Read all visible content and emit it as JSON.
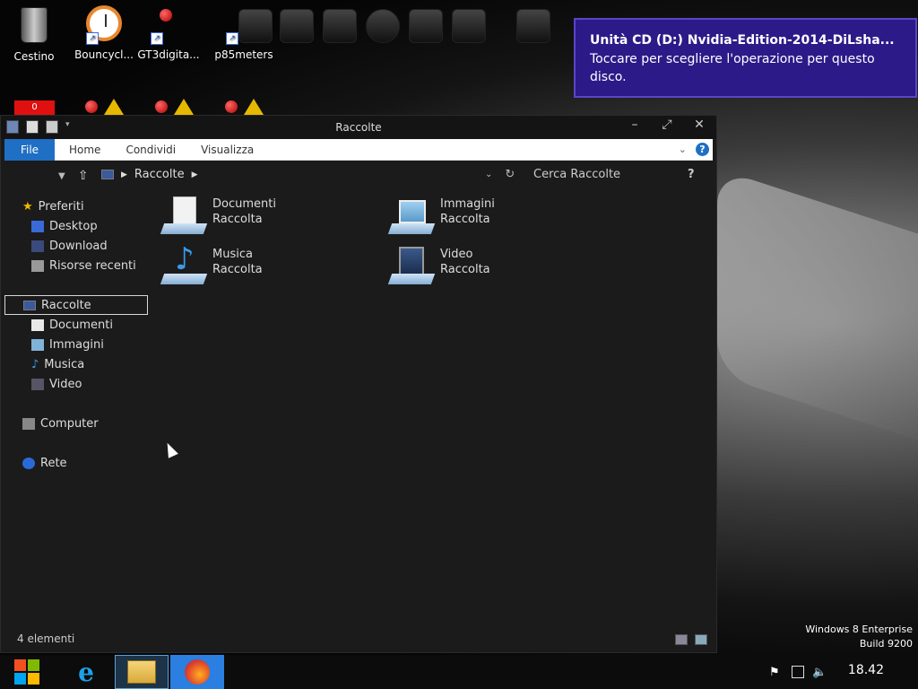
{
  "desktop": {
    "icons": [
      {
        "label": "Cestino",
        "icon": "recycle-bin-icon"
      },
      {
        "label": "Bouncycl...",
        "icon": "alarm-clock-icon"
      },
      {
        "label": "GT3digita...",
        "icon": "gauge-icon"
      },
      {
        "label": "p85meters",
        "icon": "meters-icon"
      }
    ],
    "badge": "0"
  },
  "toast": {
    "title": "Unità CD (D:) Nvidia-Edition-2014-DiLsha...",
    "body": "Toccare per scegliere l'operazione per questo disco."
  },
  "window": {
    "title": "Raccolte",
    "controls": {
      "minimize": "–",
      "maximize": "✕",
      "close": "✕"
    },
    "ribbon": {
      "file": "File",
      "tabs": [
        "Home",
        "Condividi",
        "Visualizza"
      ],
      "help": "?"
    },
    "address": {
      "crumb": "Raccolte",
      "search_placeholder": "Cerca Raccolte",
      "help": "?"
    },
    "nav": {
      "favorites_label": "Preferiti",
      "favorites": [
        "Desktop",
        "Download",
        "Risorse recenti"
      ],
      "libraries_label": "Raccolte",
      "libraries": [
        "Documenti",
        "Immagini",
        "Musica",
        "Video"
      ],
      "computer": "Computer",
      "network": "Rete"
    },
    "libraries": [
      {
        "name": "Documenti",
        "type": "Raccolta",
        "icon": "documents-library-icon"
      },
      {
        "name": "Immagini",
        "type": "Raccolta",
        "icon": "pictures-library-icon"
      },
      {
        "name": "Musica",
        "type": "Raccolta",
        "icon": "music-library-icon"
      },
      {
        "name": "Video",
        "type": "Raccolta",
        "icon": "video-library-icon"
      }
    ],
    "status": "4 elementi"
  },
  "watermark": {
    "line1": "Windows 8 Enterprise",
    "line2": "Build 9200"
  },
  "taskbar": {
    "time": "18.42"
  }
}
